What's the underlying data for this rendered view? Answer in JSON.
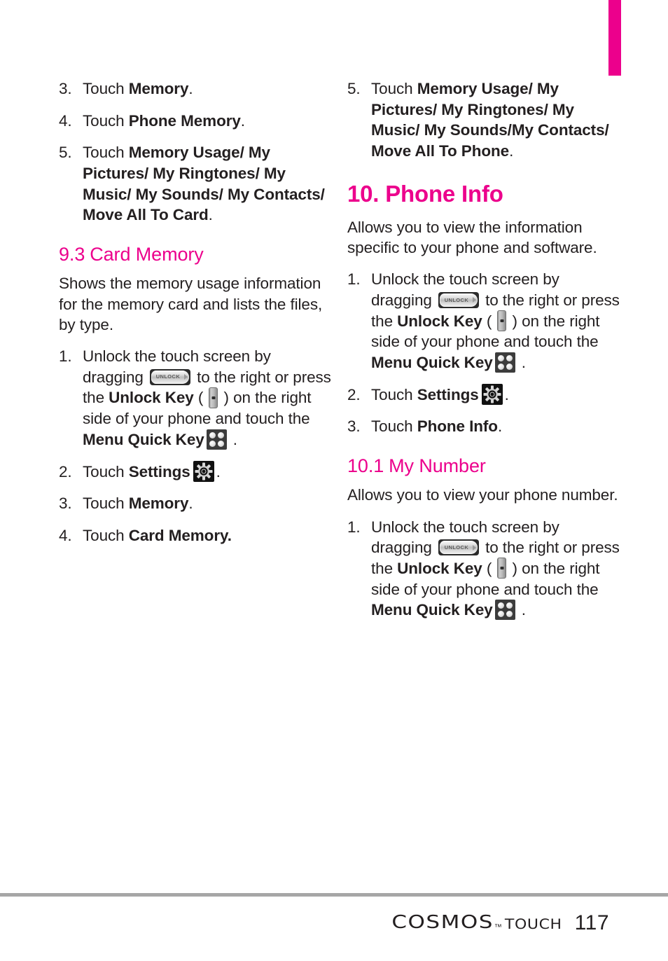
{
  "page": {
    "number": "117",
    "accent_color": "#ec008c",
    "text_color": "#231f20"
  },
  "tab_marker": {
    "color": "#ec008c"
  },
  "left_column": {
    "steps_top": [
      {
        "num": "3.",
        "pre": "Touch ",
        "bold": "Memory",
        "post": "."
      },
      {
        "num": "4.",
        "pre": "Touch ",
        "bold": "Phone Memory",
        "post": "."
      },
      {
        "num": "5.",
        "pre": "Touch ",
        "bold": "Memory Usage/ My Pictures/ My Ringtones/ My Music/ My Sounds/ My Contacts/ Move All To Card",
        "post": "."
      }
    ],
    "subsection": {
      "num": "9.3",
      "title": "Card Memory"
    },
    "intro": "Shows the memory usage information for the memory card and lists the files, by type.",
    "steps_bottom": {
      "step1": {
        "num": "1.",
        "t1": "Unlock the touch screen by dragging ",
        "t2": " to the right or press the ",
        "b1": "Unlock Key",
        "t3": " ( ",
        "t4": " ) on the right side of your phone and touch the ",
        "b2": "Menu Quick Key",
        "t5": " ."
      },
      "step2": {
        "num": "2.",
        "pre": "Touch ",
        "bold": "Settings",
        "post": "."
      },
      "step3": {
        "num": "3.",
        "pre": "Touch ",
        "bold": "Memory",
        "post": "."
      },
      "step4": {
        "num": "4.",
        "pre": "Touch ",
        "bold": "Card Memory."
      }
    }
  },
  "right_column": {
    "step5": {
      "num": "5.",
      "pre": "Touch ",
      "bold": "Memory Usage/ My Pictures/ My Ringtones/ My Music/ My Sounds/My Contacts/ Move All To Phone",
      "post": "."
    },
    "section": {
      "num": "10.",
      "title": "Phone Info"
    },
    "section_intro": "Allows you to view the information specific to your phone and software.",
    "steps": {
      "step1": {
        "num": "1.",
        "t1": "Unlock the touch screen by dragging ",
        "t2": " to the right or press the ",
        "b1": "Unlock Key",
        "t3": " ( ",
        "t4": " ) on the right side of your phone and touch the ",
        "b2": "Menu Quick Key",
        "t5": " ."
      },
      "step2": {
        "num": "2.",
        "pre": "Touch ",
        "bold": "Settings",
        "post": "."
      },
      "step3": {
        "num": "3.",
        "pre": "Touch ",
        "bold": "Phone Info",
        "post": "."
      }
    },
    "subsection": {
      "num": "10.1",
      "title": "My Number"
    },
    "subsection_intro": "Allows you to view your phone number.",
    "sub_steps": {
      "step1": {
        "num": "1.",
        "t1": "Unlock the touch screen by dragging ",
        "t2": " to the right or press the ",
        "b1": "Unlock Key",
        "t3": " ( ",
        "t4": " ) on the right side of your phone and touch the ",
        "b2": "Menu Quick Key",
        "t5": " ."
      }
    }
  },
  "icons": {
    "unlock_slider_label": "UNLOCK"
  },
  "footer": {
    "brand": "COSMOS",
    "trademark": "™",
    "sub_brand": "TOUCH",
    "page_number": "117"
  }
}
